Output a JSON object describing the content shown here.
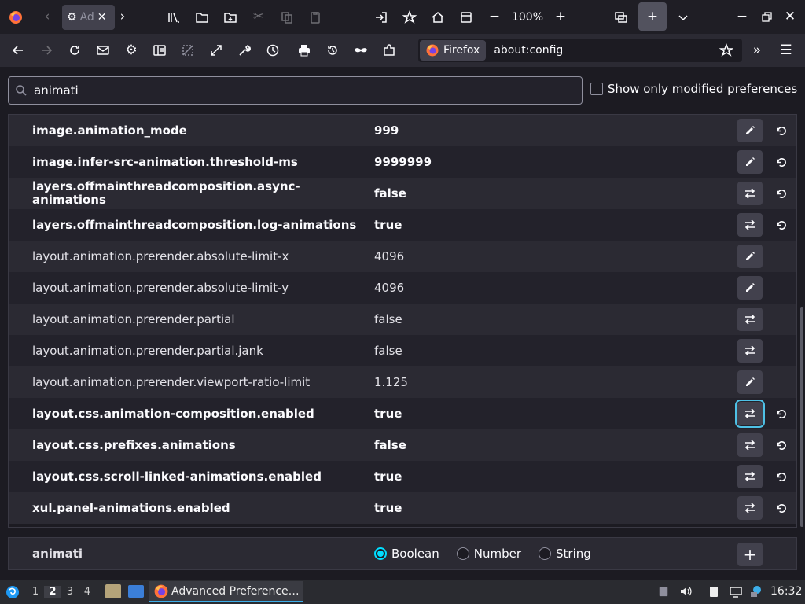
{
  "window": {
    "tab_title": "Ad",
    "zoom": "100%"
  },
  "navbar": {
    "identity_label": "Firefox",
    "url": "about:config"
  },
  "search": {
    "value": "animati",
    "modified_only_label": "Show only modified preferences"
  },
  "prefs": [
    {
      "name": "image.animation_mode",
      "value": "999",
      "modified": true,
      "type": "edit"
    },
    {
      "name": "image.infer-src-animation.threshold-ms",
      "value": "9999999",
      "modified": true,
      "type": "edit"
    },
    {
      "name": "layers.offmainthreadcomposition.async-\nanimations",
      "value": "false",
      "modified": true,
      "type": "toggle"
    },
    {
      "name": "layers.offmainthreadcomposition.log-animations",
      "value": "true",
      "modified": true,
      "type": "toggle"
    },
    {
      "name": "layout.animation.prerender.absolute-limit-x",
      "value": "4096",
      "modified": false,
      "type": "edit"
    },
    {
      "name": "layout.animation.prerender.absolute-limit-y",
      "value": "4096",
      "modified": false,
      "type": "edit"
    },
    {
      "name": "layout.animation.prerender.partial",
      "value": "false",
      "modified": false,
      "type": "toggle"
    },
    {
      "name": "layout.animation.prerender.partial.jank",
      "value": "false",
      "modified": false,
      "type": "toggle"
    },
    {
      "name": "layout.animation.prerender.viewport-ratio-limit",
      "value": "1.125",
      "modified": false,
      "type": "edit"
    },
    {
      "name": "layout.css.animation-composition.enabled",
      "value": "true",
      "modified": true,
      "type": "toggle",
      "focused": true
    },
    {
      "name": "layout.css.prefixes.animations",
      "value": "false",
      "modified": true,
      "type": "toggle"
    },
    {
      "name": "layout.css.scroll-linked-animations.enabled",
      "value": "true",
      "modified": true,
      "type": "toggle"
    },
    {
      "name": "xul.panel-animations.enabled",
      "value": "true",
      "modified": true,
      "type": "toggle"
    }
  ],
  "add_row": {
    "name": "animati",
    "types": [
      "Boolean",
      "Number",
      "String"
    ],
    "selected": "Boolean"
  },
  "taskbar": {
    "workspaces": [
      "1",
      "2",
      "3",
      "4"
    ],
    "active_workspace": "2",
    "task_label": "Advanced Preference…",
    "clock": "16:32"
  },
  "colors": {
    "accent": "#00ddff",
    "focus_ring": "#4ec1e6",
    "background": "#1c1b22"
  }
}
